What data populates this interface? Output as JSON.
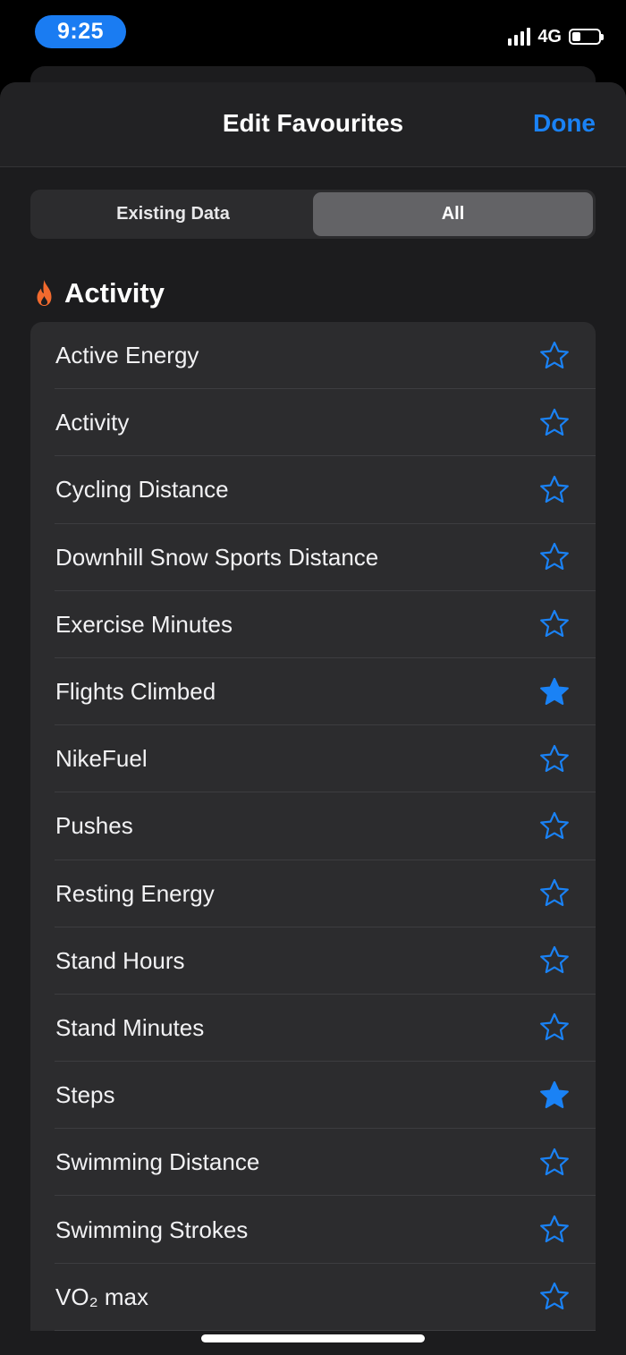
{
  "status_bar": {
    "time": "9:25",
    "network": "4G"
  },
  "sheet": {
    "title": "Edit Favourites",
    "done_label": "Done"
  },
  "segments": [
    {
      "label": "Existing Data",
      "active": false
    },
    {
      "label": "All",
      "active": true
    }
  ],
  "section": {
    "title": "Activity",
    "icon": "flame-icon",
    "icon_color": "#f26a2e"
  },
  "colors": {
    "accent": "#1a82f5",
    "time_pill": "#1a7cf2"
  },
  "items": [
    {
      "label": "Active Energy",
      "favourite": false
    },
    {
      "label": "Activity",
      "favourite": false
    },
    {
      "label": "Cycling Distance",
      "favourite": false
    },
    {
      "label": "Downhill Snow Sports Distance",
      "favourite": false
    },
    {
      "label": "Exercise Minutes",
      "favourite": false
    },
    {
      "label": "Flights Climbed",
      "favourite": true
    },
    {
      "label": "NikeFuel",
      "favourite": false
    },
    {
      "label": "Pushes",
      "favourite": false
    },
    {
      "label": "Resting Energy",
      "favourite": false
    },
    {
      "label": "Stand Hours",
      "favourite": false
    },
    {
      "label": "Stand Minutes",
      "favourite": false
    },
    {
      "label": "Steps",
      "favourite": true
    },
    {
      "label": "Swimming Distance",
      "favourite": false
    },
    {
      "label": "Swimming Strokes",
      "favourite": false
    },
    {
      "label": "VO₂ max",
      "favourite": false
    }
  ]
}
